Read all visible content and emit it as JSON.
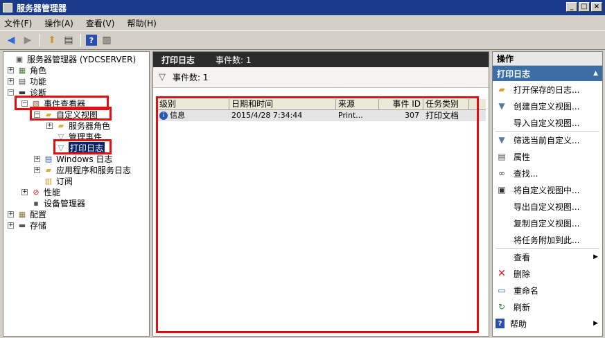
{
  "window": {
    "title": "服务器管理器"
  },
  "menu": [
    "文件(F)",
    "操作(A)",
    "查看(V)",
    "帮助(H)"
  ],
  "tree": {
    "root": "服务器管理器 (YDCSERVER)",
    "roles": "角色",
    "features": "功能",
    "diagnostics": "诊断",
    "event_viewer": "事件查看器",
    "custom_views": "自定义视图",
    "server_roles": "服务器角色",
    "admin_events": "管理事件",
    "print_log": "打印日志",
    "windows_logs": "Windows 日志",
    "app_service_logs": "应用程序和服务日志",
    "subscriptions": "订阅",
    "performance": "性能",
    "device_manager": "设备管理器",
    "configuration": "配置",
    "storage": "存储"
  },
  "center": {
    "title": "打印日志",
    "event_count_header": "事件数: 1",
    "filter_text": "事件数: 1",
    "columns": [
      "级别",
      "日期和时间",
      "来源",
      "事件 ID",
      "任务类别"
    ],
    "rows": [
      {
        "level": "信息",
        "datetime": "2015/4/28 7:34:44",
        "source": "Print...",
        "event_id": "307",
        "category": "打印文档"
      }
    ]
  },
  "actions": {
    "header": "操作",
    "section": "打印日志",
    "items": [
      {
        "label": "打开保存的日志...",
        "icon": "folder-open-icon"
      },
      {
        "label": "创建自定义视图...",
        "icon": "filter-create-icon"
      },
      {
        "label": "导入自定义视图...",
        "icon": "none"
      },
      {
        "label": "筛选当前自定义...",
        "icon": "filter-icon"
      },
      {
        "label": "属性",
        "icon": "properties-icon"
      },
      {
        "label": "查找...",
        "icon": "binoculars-icon"
      },
      {
        "label": "将自定义视图中...",
        "icon": "save-icon"
      },
      {
        "label": "导出自定义视图...",
        "icon": "none"
      },
      {
        "label": "复制自定义视图...",
        "icon": "none"
      },
      {
        "label": "将任务附加到此...",
        "icon": "none"
      },
      {
        "label": "查看",
        "icon": "none"
      },
      {
        "label": "删除",
        "icon": "delete-icon"
      },
      {
        "label": "重命名",
        "icon": "rename-icon"
      },
      {
        "label": "刷新",
        "icon": "refresh-icon"
      },
      {
        "label": "帮助",
        "icon": "help-icon"
      }
    ]
  },
  "colors": {
    "titlebar": "#1a3a8a",
    "highlight": "#e01010",
    "selection": "#0a246a",
    "action_section": "#3a6ea5"
  }
}
